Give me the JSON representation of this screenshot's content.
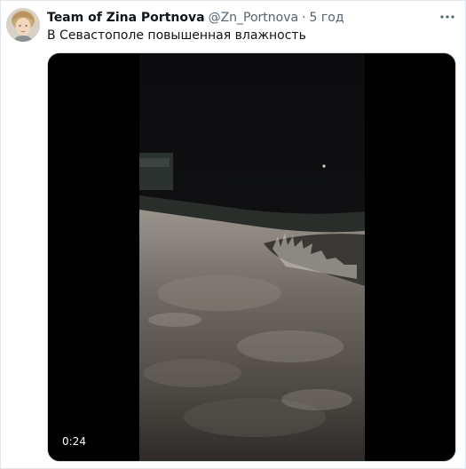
{
  "tweet": {
    "author": {
      "display_name": "Team of Zina Portnova",
      "handle": "@Zn_Portnova",
      "separator": "·",
      "time": "5 год"
    },
    "text": "В Севастополе повышенная влажность",
    "media": {
      "type": "video",
      "duration": "0:24"
    },
    "icons": {
      "avatar": "avatar",
      "more": "more-options-icon"
    }
  }
}
